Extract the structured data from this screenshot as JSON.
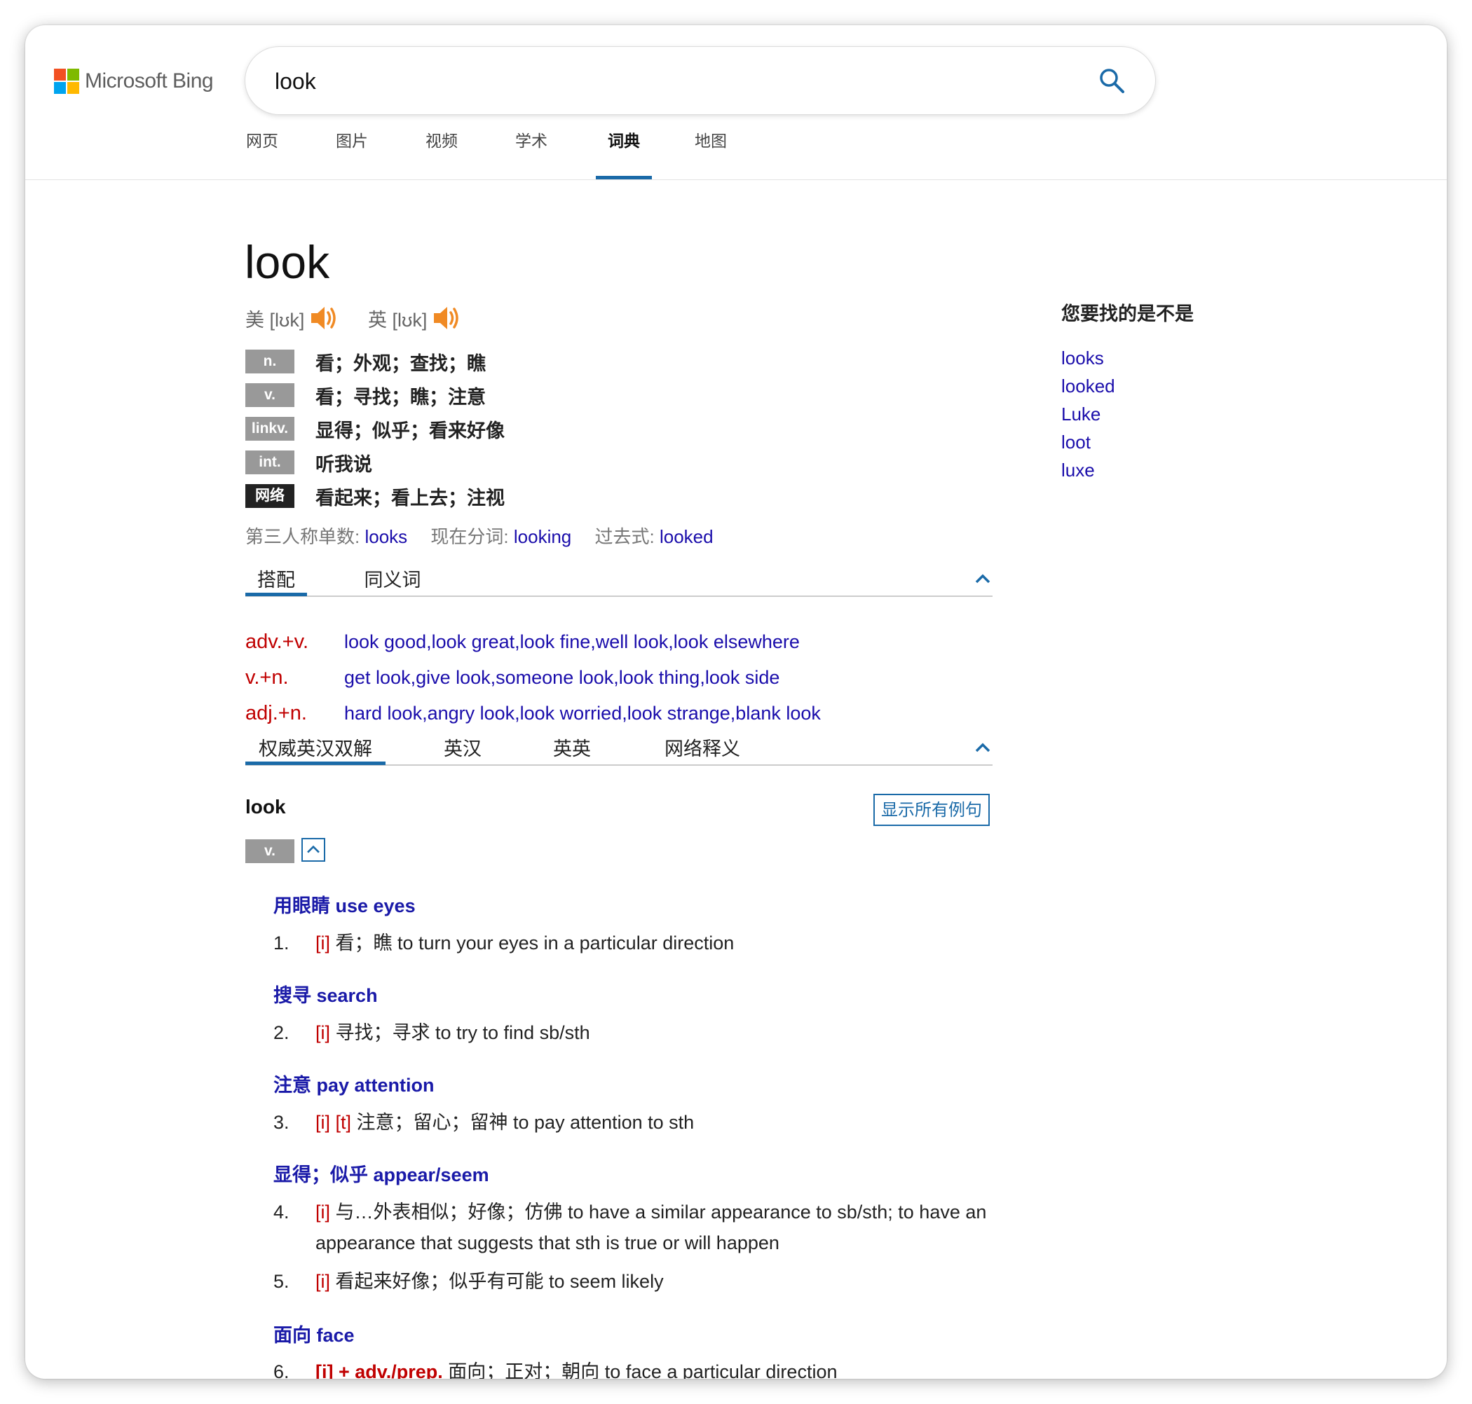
{
  "brand": {
    "name": "Microsoft Bing",
    "logo_colors": [
      "#f25022",
      "#7fba00",
      "#00a4ef",
      "#ffb900"
    ],
    "accent": "#1a6aa8",
    "link_color": "#1a0dab",
    "tag_color": "#c00000"
  },
  "search": {
    "value": "look",
    "icon": "search-icon"
  },
  "nav": {
    "items": [
      {
        "label": "网页"
      },
      {
        "label": "图片"
      },
      {
        "label": "视频"
      },
      {
        "label": "学术"
      },
      {
        "label": "词典",
        "active": true
      },
      {
        "label": "地图"
      }
    ]
  },
  "entry": {
    "word": "look",
    "pron_us": "美 [lʊk]",
    "pron_uk": "英 [lʊk]",
    "speaker_icon": "speaker-icon",
    "definitions": [
      {
        "pos": "n.",
        "text": "看；外观；查找；瞧"
      },
      {
        "pos": "v.",
        "text": "看；寻找；瞧；注意"
      },
      {
        "pos": "linkv.",
        "text": "显得；似乎；看来好像"
      },
      {
        "pos": "int.",
        "text": "听我说"
      },
      {
        "pos": "网络",
        "text": "看起来；看上去；注视"
      }
    ],
    "inflections": {
      "third_label": "第三人称单数:",
      "third": "looks",
      "present_label": "现在分词:",
      "present": "looking",
      "past_label": "过去式:",
      "past": "looked"
    }
  },
  "collocation_tabs": [
    {
      "label": "搭配",
      "active": true
    },
    {
      "label": "同义词"
    }
  ],
  "collocations": [
    {
      "type": "adv.+v.",
      "list": "look good,look great,look fine,well look,look elsewhere"
    },
    {
      "type": "v.+n.",
      "list": "get look,give look,someone look,look thing,look side"
    },
    {
      "type": "adj.+n.",
      "list": "hard look,angry look,look worried,look strange,blank look"
    }
  ],
  "definition_tabs": [
    {
      "label": "权威英汉双解",
      "active": true
    },
    {
      "label": "英汉"
    },
    {
      "label": "英英"
    },
    {
      "label": "网络释义"
    }
  ],
  "detail": {
    "word": "look",
    "show_all_label": "显示所有例句",
    "pos": "v.",
    "senses": [
      {
        "heading": "用眼睛 use eyes",
        "items": [
          {
            "num": "1.",
            "tags": "[i]",
            "text": " 看；瞧 to turn your eyes in a particular direction"
          }
        ]
      },
      {
        "heading": "搜寻 search",
        "items": [
          {
            "num": "2.",
            "tags": "[i]",
            "text": " 寻找；寻求 to try to find sb/sth"
          }
        ]
      },
      {
        "heading": "注意 pay attention",
        "items": [
          {
            "num": "3.",
            "tags": "[i] [t]",
            "text": " 注意；留心；留神 to pay attention to sth"
          }
        ]
      },
      {
        "heading": "显得；似乎 appear/seem",
        "items": [
          {
            "num": "4.",
            "tags": "[i]",
            "text": " 与…外表相似；好像；仿佛 to have a similar appearance to sb/sth; to have an appearance that suggests that sth is true or will happen"
          },
          {
            "num": "5.",
            "tags": "[i]",
            "text": " 看起来好像；似乎有可能 to seem likely"
          }
        ]
      },
      {
        "heading": "面向 face",
        "items": [
          {
            "num": "6.",
            "tags": "[i] + adv./prep.",
            "text": " 面向；正对；朝向 to face a particular direction"
          }
        ]
      }
    ]
  },
  "sidebar": {
    "title": "您要找的是不是",
    "links": [
      "looks",
      "looked",
      "Luke",
      "loot",
      "luxe"
    ]
  }
}
